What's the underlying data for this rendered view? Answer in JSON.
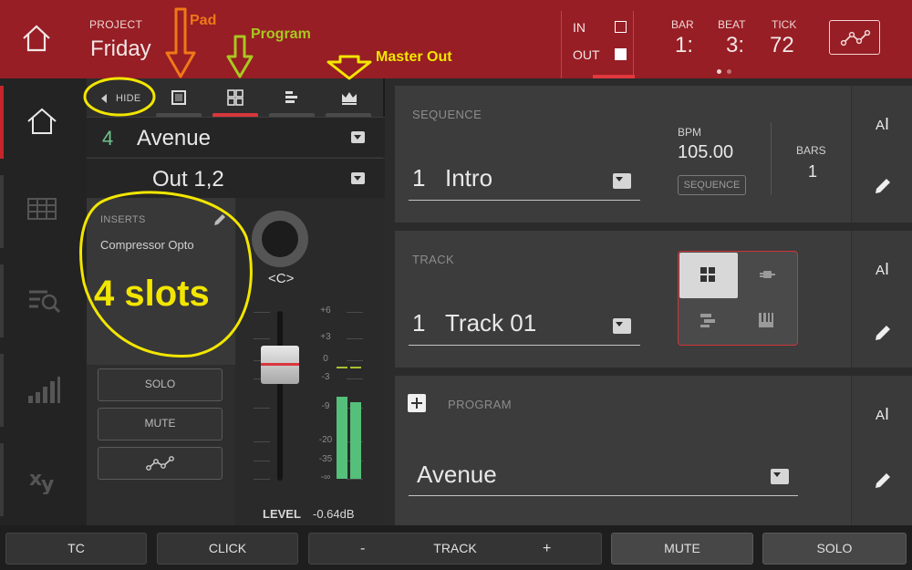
{
  "header": {
    "project_label": "PROJECT",
    "project_name": "Friday",
    "in_label": "IN",
    "out_label": "OUT",
    "bar_label": "BAR",
    "bar_value": "1:",
    "beat_label": "BEAT",
    "beat_value": "3:",
    "tick_label": "TICK",
    "tick_value": "72"
  },
  "rail": {
    "items": [
      {
        "icon": "home-icon",
        "active": true
      },
      {
        "icon": "grid-icon",
        "active": false
      },
      {
        "icon": "browse-search-icon",
        "active": false
      },
      {
        "icon": "levels-icon",
        "active": false
      },
      {
        "icon": "xy-icon",
        "active": false
      }
    ]
  },
  "mixer": {
    "hide_label": "HIDE",
    "tabs": [
      "pad-icon",
      "program-icon",
      "list-icon",
      "master-out-icon"
    ],
    "active_tab": 1,
    "program_number": "4",
    "program_name": "Avenue",
    "output": "Out 1,2",
    "inserts_header": "INSERTS",
    "insert_slot": "Compressor Opto",
    "pan_label": "<C>",
    "solo_label": "SOLO",
    "mute_label": "MUTE",
    "level_label": "LEVEL",
    "level_value": "-0.64dB",
    "db_scale": [
      "+6",
      "+3",
      "0",
      "-3",
      "-9",
      "-20",
      "-35",
      "-∞"
    ],
    "meter_left_level": 0.45,
    "meter_right_level": 0.42
  },
  "sequence": {
    "tag": "SEQUENCE",
    "number": "1",
    "name": "Intro",
    "bpm_label": "BPM",
    "bpm_value": "105.00",
    "tempo_source": "SEQUENCE",
    "bars_label": "BARS",
    "bars_value": "1"
  },
  "track": {
    "tag": "TRACK",
    "number": "1",
    "name": "Track 01",
    "types": [
      "drum-grid-icon",
      "plugin-icon",
      "clip-icon",
      "keygroup-icon"
    ]
  },
  "program": {
    "tag": "PROGRAM",
    "name": "Avenue"
  },
  "side": {
    "ai_label": "A",
    "edit_icon": "pencil-icon"
  },
  "bottom": {
    "tc": "TC",
    "click": "CLICK",
    "track_minus": "-",
    "track": "TRACK",
    "track_plus": "+",
    "mute": "MUTE",
    "solo": "SOLO"
  },
  "annotations": {
    "pad": "Pad",
    "program": "Program",
    "master_out": "Master Out",
    "slots": "4 slots",
    "colors": {
      "pad": "#f07818",
      "program": "#a8c820",
      "master_out": "#f2e600",
      "slots": "#f2e600"
    }
  }
}
